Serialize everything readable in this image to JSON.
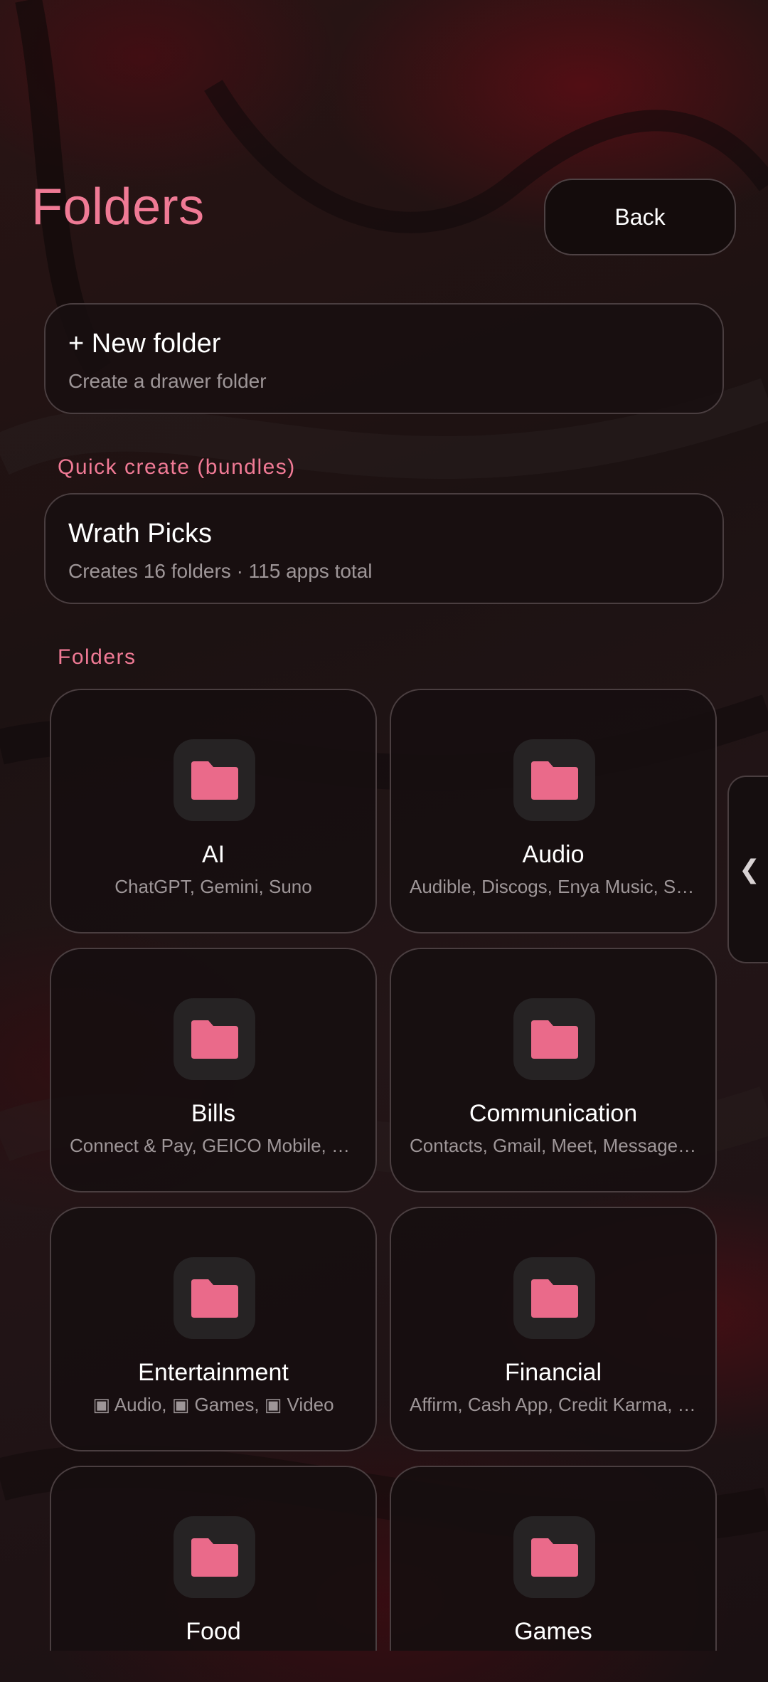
{
  "header": {
    "title": "Folders",
    "back_label": "Back"
  },
  "new_folder": {
    "title": "+ New folder",
    "subtitle": "Create a drawer folder"
  },
  "quick_create": {
    "section_label": "Quick create (bundles)",
    "bundle": {
      "title": "Wrath Picks",
      "subtitle": "Creates 16 folders · 115 apps total"
    }
  },
  "folders": {
    "section_label": "Folders",
    "items": [
      {
        "name": "AI",
        "apps": "ChatGPT, Gemini, Suno"
      },
      {
        "name": "Audio",
        "apps": "Audible, Discogs, Enya Music, Son..."
      },
      {
        "name": "Bills",
        "apps": "Connect & Pay, GEICO Mobile, My ..."
      },
      {
        "name": "Communication",
        "apps": "Contacts, Gmail, Meet, Messages, ..."
      },
      {
        "name": "Entertainment",
        "apps": "▣ Audio, ▣ Games, ▣ Video"
      },
      {
        "name": "Financial",
        "apps": "Affirm, Cash App, Credit Karma, Kl..."
      },
      {
        "name": "Food",
        "apps": ""
      },
      {
        "name": "Games",
        "apps": ""
      }
    ]
  },
  "side_handle": {
    "icon": "chevron-left-icon",
    "glyph": "❮"
  },
  "colors": {
    "accent": "#f07a95",
    "folder_icon": "#ea6a8a",
    "background": "#1a0f10"
  }
}
